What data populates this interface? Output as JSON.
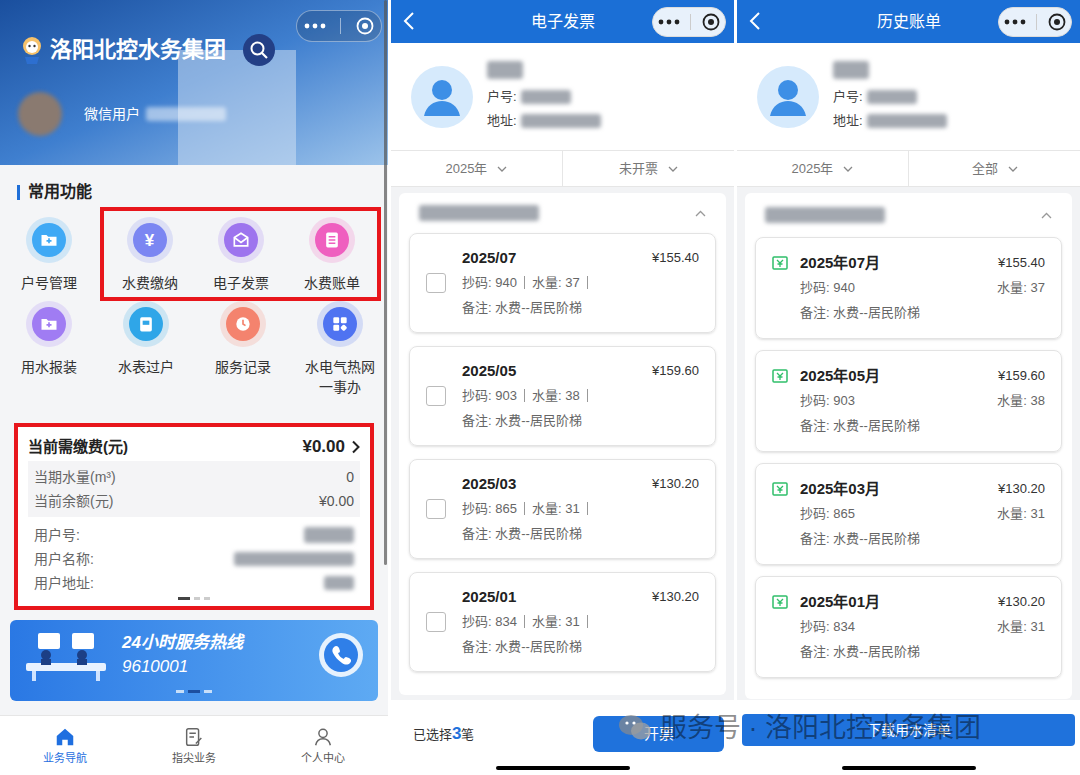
{
  "home": {
    "brand": "洛阳北控水务集团",
    "user": "微信用户",
    "section_title": "常用功能",
    "function_rows": [
      [
        {
          "label": "户号管理",
          "color": "#3fa9f5",
          "highlighted": false
        },
        {
          "label": "水费缴纳",
          "glyph": "¥",
          "color": "#7b86f2",
          "highlighted": true
        },
        {
          "label": "电子发票",
          "color": "#9d74ee",
          "highlighted": true
        },
        {
          "label": "水费账单",
          "color": "#ef5fbf",
          "highlighted": true
        }
      ],
      [
        {
          "label": "用水报装",
          "color": "#a07cf3",
          "highlighted": false
        },
        {
          "label": "水表过户",
          "color": "#2fa6e8",
          "highlighted": false
        },
        {
          "label": "服务记录",
          "color": "#f4836e",
          "highlighted": false
        },
        {
          "label": "水电气热网一事办",
          "color": "#4f73f1",
          "highlighted": false
        }
      ]
    ],
    "bill_card": {
      "highlighted": true,
      "title": "当前需缴费(元)",
      "amount": "¥0.00",
      "summary": [
        {
          "label": "当期水量(m³)",
          "value": "0"
        },
        {
          "label": "当前余额(元)",
          "value": "¥0.00"
        }
      ],
      "fields": [
        {
          "label": "用户号:"
        },
        {
          "label": "用户名称:"
        },
        {
          "label": "用户地址:"
        }
      ],
      "pager": [
        {
          "selected": true
        },
        {
          "selected": false
        },
        {
          "selected": false
        }
      ]
    },
    "hotline": {
      "title": "24小时服务热线",
      "number": "9610001",
      "pager": [
        {
          "selected": false
        },
        {
          "selected": true
        },
        {
          "selected": false
        }
      ]
    },
    "nav": [
      {
        "label": "业务导航",
        "selected": true
      },
      {
        "label": "指尖业务",
        "selected": false
      },
      {
        "label": "个人中心",
        "selected": false
      }
    ]
  },
  "invoice": {
    "title": "电子发票",
    "profile": {
      "id_label": "户号:",
      "address_label": "地址:"
    },
    "filters": [
      {
        "label": "2025年"
      },
      {
        "label": "未开票"
      }
    ],
    "items": [
      {
        "period": "2025/07",
        "amount": "¥155.40",
        "reading": "抄码: 940",
        "volume": "水量: 37",
        "note": "备注: 水费--居民阶梯",
        "checked": false
      },
      {
        "period": "2025/05",
        "amount": "¥159.60",
        "reading": "抄码: 903",
        "volume": "水量: 38",
        "note": "备注: 水费--居民阶梯",
        "checked": false
      },
      {
        "period": "2025/03",
        "amount": "¥130.20",
        "reading": "抄码: 865",
        "volume": "水量: 31",
        "note": "备注: 水费--居民阶梯",
        "checked": false
      },
      {
        "period": "2025/01",
        "amount": "¥130.20",
        "reading": "抄码: 834",
        "volume": "水量: 31",
        "note": "备注: 水费--居民阶梯",
        "checked": false
      }
    ],
    "footer": {
      "prefix": "已选择",
      "count": "3",
      "suffix": "笔",
      "button": "开票"
    }
  },
  "history": {
    "title": "历史账单",
    "profile": {
      "id_label": "户号:",
      "address_label": "地址:"
    },
    "filters": [
      {
        "label": "2025年"
      },
      {
        "label": "全部"
      }
    ],
    "items": [
      {
        "period": "2025年07月",
        "amount": "¥155.40",
        "reading": "抄码: 940",
        "volume": "水量: 37",
        "note": "备注: 水费--居民阶梯"
      },
      {
        "period": "2025年05月",
        "amount": "¥159.60",
        "reading": "抄码: 903",
        "volume": "水量: 38",
        "note": "备注: 水费--居民阶梯"
      },
      {
        "period": "2025年03月",
        "amount": "¥130.20",
        "reading": "抄码: 865",
        "volume": "水量: 31",
        "note": "备注: 水费--居民阶梯"
      },
      {
        "period": "2025年01月",
        "amount": "¥130.20",
        "reading": "抄码: 834",
        "volume": "水量: 31",
        "note": "备注: 水费--居民阶梯"
      }
    ],
    "footer": {
      "button": "下载用水清单"
    }
  },
  "watermark": "服务号 · 洛阳北控水务集团"
}
